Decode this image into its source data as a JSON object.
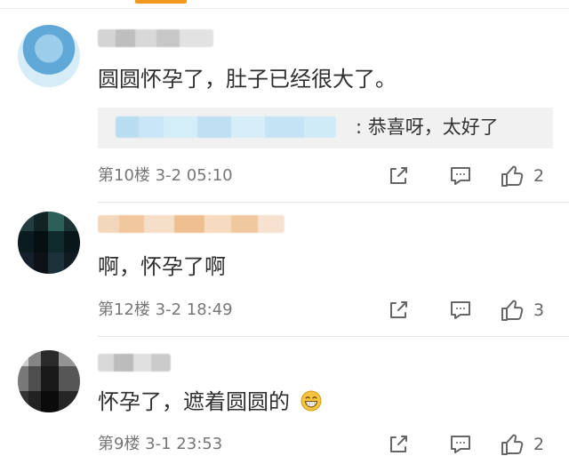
{
  "comments": [
    {
      "text": "圆圆怀孕了，肚子已经很大了。",
      "reply": {
        "text": ": 恭喜呀，太好了"
      },
      "meta": "第10楼 3-2 05:10",
      "likes": "2",
      "icons": {
        "share": "share-icon",
        "comment": "comment-icon",
        "like": "thumb-up-icon"
      }
    },
    {
      "text": "啊，怀孕了啊",
      "meta": "第12楼 3-2 18:49",
      "likes": "3",
      "icons": {
        "share": "share-icon",
        "comment": "comment-icon",
        "like": "thumb-up-icon"
      }
    },
    {
      "text": "怀孕了，遮着圆圆的",
      "meta": "第9楼 3-1 23:53",
      "likes": "2",
      "emoji": "grinning-face-emoji",
      "icons": {
        "share": "share-icon",
        "comment": "comment-icon",
        "like": "thumb-up-icon"
      }
    }
  ],
  "colors": {
    "accent": "#f29a1f",
    "text": "#2f2f2f",
    "meta": "#777777",
    "reply_bg": "#f1f1f1"
  }
}
